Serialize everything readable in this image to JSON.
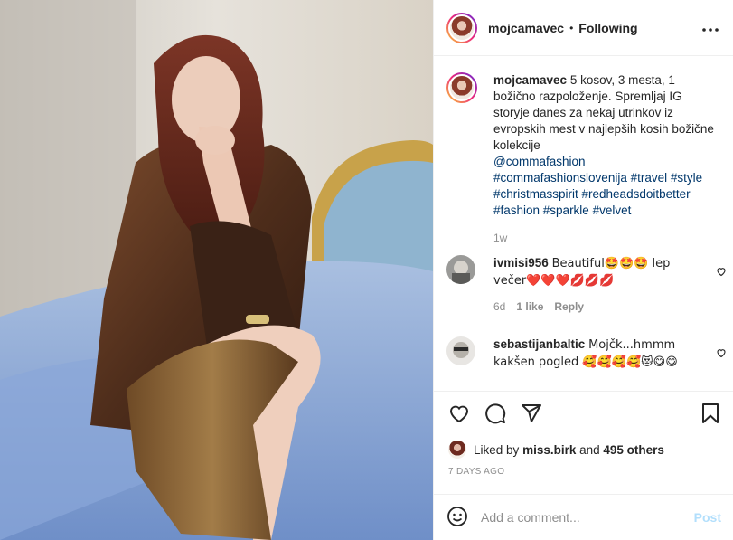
{
  "post": {
    "username": "mojcamavec",
    "separator": "•",
    "follow_status": "Following",
    "more_glyph": "•••"
  },
  "caption": {
    "username": "mojcamavec",
    "text": "5 kosov, 3 mesta, 1 božično razpoloženje. Spremljaj IG storyje danes za nekaj utrinkov iz evropskih mest v najlepših kosih božične kolekcije",
    "mention": "@commafashion",
    "hashtags": "#commafashionslovenija #travel #style #christmasspirit #redheadsdoitbetter #fashion #sparkle #velvet",
    "time": "1w"
  },
  "comments": [
    {
      "username": "ivmisi956",
      "text": "Beautiful🤩🤩🤩 lep večer❤️❤️❤️💋💋💋",
      "time": "6d",
      "likes": "1 like",
      "reply": "Reply"
    },
    {
      "username": "sebastijanbaltic",
      "text": "Mojčk...hmmm kakšen pogled 🥰🥰🥰🥰😻😋😋",
      "time": "",
      "likes": "",
      "reply": ""
    }
  ],
  "likes": {
    "prefix": "Liked by",
    "user": "miss.birk",
    "suffix": "and",
    "others": "495 others"
  },
  "timestamp": "7 DAYS AGO",
  "add_comment": {
    "placeholder": "Add a comment...",
    "post_label": "Post"
  },
  "colors": {
    "link": "#00376b",
    "muted": "#8e8e8e",
    "post_disabled": "#b2dffc",
    "heart_red": "#ed4956"
  },
  "icons": [
    "heart-icon",
    "comment-icon",
    "share-icon",
    "bookmark-icon",
    "emoji-icon",
    "more-icon",
    "like-comment-icon"
  ]
}
